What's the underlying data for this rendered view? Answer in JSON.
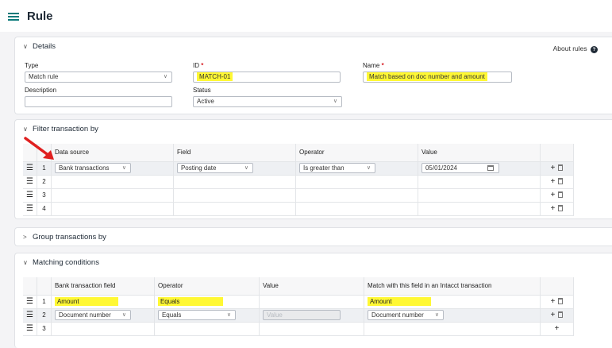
{
  "page": {
    "title": "Rule"
  },
  "details": {
    "title": "Details",
    "about_label": "About rules",
    "type_label": "Type",
    "type_value": "Match rule",
    "id_label": "ID",
    "id_value": "MATCH-01",
    "name_label": "Name",
    "name_value": "Match based on doc number and amount",
    "description_label": "Description",
    "description_value": "",
    "status_label": "Status",
    "status_value": "Active",
    "required_mark": "*"
  },
  "filter": {
    "title": "Filter transaction by",
    "headers": [
      "Data source",
      "Field",
      "Operator",
      "Value"
    ],
    "rows": [
      {
        "num": "1",
        "source": "Bank transactions",
        "field": "Posting date",
        "operator": "Is greater than",
        "value": "05/01/2024"
      },
      {
        "num": "2"
      },
      {
        "num": "3"
      },
      {
        "num": "4"
      }
    ]
  },
  "group": {
    "title": "Group transactions by"
  },
  "matching": {
    "title": "Matching conditions",
    "headers": [
      "Bank transaction field",
      "Operator",
      "Value",
      "Match with this field in an Intacct transaction"
    ],
    "rows": [
      {
        "num": "1",
        "field": "Amount",
        "operator": "Equals",
        "value": "",
        "match": "Amount"
      },
      {
        "num": "2",
        "field": "Document number",
        "operator": "Equals",
        "value_placeholder": "Value",
        "match": "Document number"
      },
      {
        "num": "3"
      }
    ]
  },
  "icons": {
    "drag": "☰",
    "add": "+",
    "chevron_down": "⌄",
    "chevron_right": "›"
  },
  "colors": {
    "highlight_yellow": "#fff834",
    "highlight_cyan": "#2de6e6",
    "accent": "#0a7a7a",
    "arrow": "#e02020"
  }
}
